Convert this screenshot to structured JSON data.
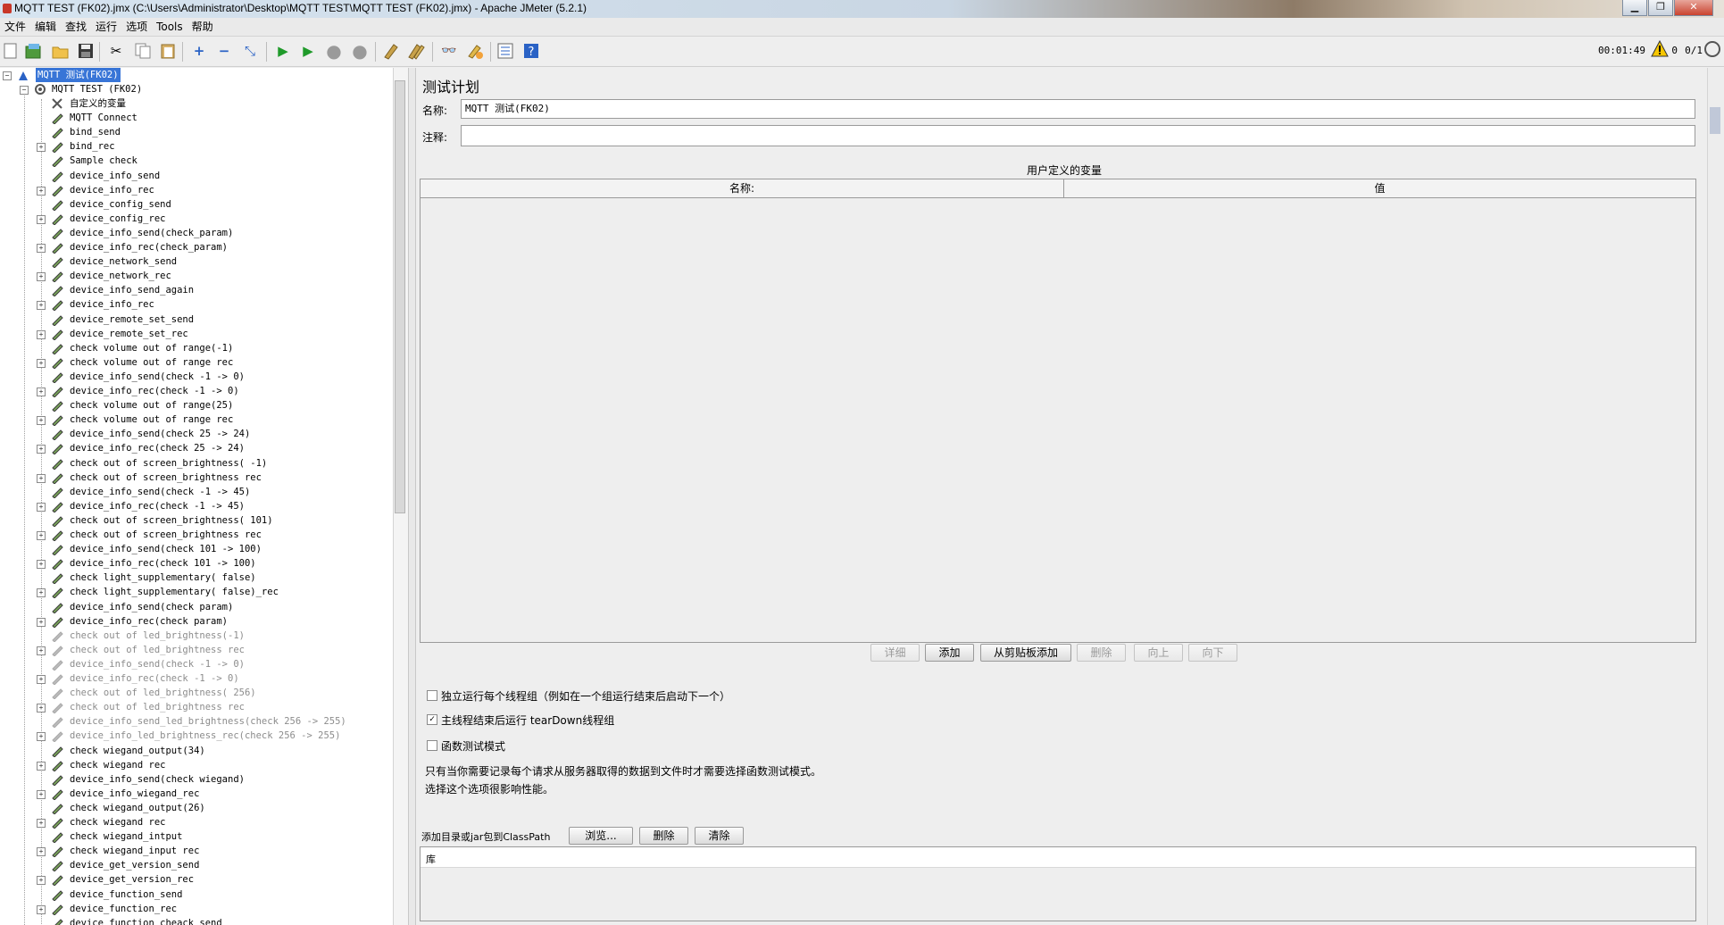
{
  "window": {
    "title": "MQTT TEST (FK02).jmx (C:\\Users\\Administrator\\Desktop\\MQTT TEST\\MQTT TEST (FK02).jmx) - Apache JMeter (5.2.1)"
  },
  "menu": [
    "文件",
    "编辑",
    "查找",
    "运行",
    "选项",
    "Tools",
    "帮助"
  ],
  "toolbar": {
    "icons": [
      "new-icon",
      "templates-icon",
      "open-icon",
      "save-icon",
      "cut-icon",
      "copy-icon",
      "paste-icon",
      "expand-icon",
      "collapse-icon",
      "toggle-icon",
      "start-icon",
      "start-no-pause-icon",
      "stop-icon",
      "shutdown-icon",
      "clear-icon",
      "clear-all-icon",
      "search-icon",
      "reset-search-icon",
      "function-helper-icon",
      "help-icon"
    ],
    "timer": "00:01:49",
    "error_count": "0",
    "thread_count": "0/1"
  },
  "tree": {
    "root": "MQTT 测试(FK02)",
    "plan": "MQTT TEST (FK02)",
    "items": [
      {
        "label": "自定义的变量",
        "expand": false,
        "disabled": false
      },
      {
        "label": "MQTT Connect",
        "expand": false,
        "disabled": false
      },
      {
        "label": "bind_send",
        "expand": false,
        "disabled": false
      },
      {
        "label": "bind_rec",
        "expand": true,
        "disabled": false
      },
      {
        "label": "Sample check",
        "expand": false,
        "disabled": false
      },
      {
        "label": "device_info_send",
        "expand": false,
        "disabled": false
      },
      {
        "label": "device_info_rec",
        "expand": true,
        "disabled": false
      },
      {
        "label": "device_config_send",
        "expand": false,
        "disabled": false
      },
      {
        "label": "device_config_rec",
        "expand": true,
        "disabled": false
      },
      {
        "label": "device_info_send(check_param)",
        "expand": false,
        "disabled": false
      },
      {
        "label": "device_info_rec(check_param)",
        "expand": true,
        "disabled": false
      },
      {
        "label": "device_network_send",
        "expand": false,
        "disabled": false
      },
      {
        "label": "device_network_rec",
        "expand": true,
        "disabled": false
      },
      {
        "label": "device_info_send_again",
        "expand": false,
        "disabled": false
      },
      {
        "label": "device_info_rec",
        "expand": true,
        "disabled": false
      },
      {
        "label": "device_remote_set_send",
        "expand": false,
        "disabled": false
      },
      {
        "label": "device_remote_set_rec",
        "expand": true,
        "disabled": false
      },
      {
        "label": "check volume out of range(-1)",
        "expand": false,
        "disabled": false
      },
      {
        "label": "check volume out of range rec",
        "expand": true,
        "disabled": false
      },
      {
        "label": "device_info_send(check -1 -> 0)",
        "expand": false,
        "disabled": false
      },
      {
        "label": "device_info_rec(check -1 -> 0)",
        "expand": true,
        "disabled": false
      },
      {
        "label": "check volume out of range(25)",
        "expand": false,
        "disabled": false
      },
      {
        "label": "check volume out of range rec",
        "expand": true,
        "disabled": false
      },
      {
        "label": "device_info_send(check 25 -> 24)",
        "expand": false,
        "disabled": false
      },
      {
        "label": "device_info_rec(check 25 -> 24)",
        "expand": true,
        "disabled": false
      },
      {
        "label": "check out of screen_brightness( -1)",
        "expand": false,
        "disabled": false
      },
      {
        "label": "check out of screen_brightness rec",
        "expand": true,
        "disabled": false
      },
      {
        "label": "device_info_send(check -1 -> 45)",
        "expand": false,
        "disabled": false
      },
      {
        "label": "device_info_rec(check -1 -> 45)",
        "expand": true,
        "disabled": false
      },
      {
        "label": "check out of screen_brightness( 101)",
        "expand": false,
        "disabled": false
      },
      {
        "label": "check out of screen_brightness rec",
        "expand": true,
        "disabled": false
      },
      {
        "label": "device_info_send(check 101 -> 100)",
        "expand": false,
        "disabled": false
      },
      {
        "label": "device_info_rec(check 101 -> 100)",
        "expand": true,
        "disabled": false
      },
      {
        "label": "check light_supplementary( false)",
        "expand": false,
        "disabled": false
      },
      {
        "label": "check light_supplementary( false)_rec",
        "expand": true,
        "disabled": false
      },
      {
        "label": "device_info_send(check  param)",
        "expand": false,
        "disabled": false
      },
      {
        "label": "device_info_rec(check  param)",
        "expand": true,
        "disabled": false
      },
      {
        "label": "check  out of led_brightness(-1)",
        "expand": false,
        "disabled": true
      },
      {
        "label": "check out of led_brightness rec",
        "expand": true,
        "disabled": true
      },
      {
        "label": "device_info_send(check -1 -> 0)",
        "expand": false,
        "disabled": true
      },
      {
        "label": "device_info_rec(check -1 -> 0)",
        "expand": true,
        "disabled": true
      },
      {
        "label": "check out of led_brightness( 256)",
        "expand": false,
        "disabled": true
      },
      {
        "label": "check out of led_brightness rec",
        "expand": true,
        "disabled": true
      },
      {
        "label": "device_info_send_led_brightness(check 256 -> 255)",
        "expand": false,
        "disabled": true
      },
      {
        "label": "device_info_led_brightness_rec(check 256 -> 255)",
        "expand": true,
        "disabled": true
      },
      {
        "label": "check wiegand_output(34)",
        "expand": false,
        "disabled": false
      },
      {
        "label": "check wiegand rec",
        "expand": true,
        "disabled": false
      },
      {
        "label": "device_info_send(check wiegand)",
        "expand": false,
        "disabled": false
      },
      {
        "label": "device_info_wiegand_rec",
        "expand": true,
        "disabled": false
      },
      {
        "label": "check wiegand_output(26)",
        "expand": false,
        "disabled": false
      },
      {
        "label": "check wiegand rec",
        "expand": true,
        "disabled": false
      },
      {
        "label": "check wiegand_intput",
        "expand": false,
        "disabled": false
      },
      {
        "label": "check wiegand_input rec",
        "expand": true,
        "disabled": false
      },
      {
        "label": "device_get_version_send",
        "expand": false,
        "disabled": false
      },
      {
        "label": "device_get_version_rec",
        "expand": true,
        "disabled": false
      },
      {
        "label": "device_function_send",
        "expand": false,
        "disabled": false
      },
      {
        "label": "device_function_rec",
        "expand": true,
        "disabled": false
      },
      {
        "label": "device_function_cheack_send",
        "expand": false,
        "disabled": false
      }
    ]
  },
  "panel": {
    "heading": "测试计划",
    "name_label": "名称:",
    "name_value": "MQTT 测试(FK02)",
    "comment_label": "注释:",
    "comment_value": "",
    "table_title": "用户定义的变量",
    "col_name": "名称:",
    "col_value": "值",
    "buttons": [
      {
        "label": "详细",
        "enabled": false
      },
      {
        "label": "添加",
        "enabled": true
      },
      {
        "label": "从剪贴板添加",
        "enabled": true
      },
      {
        "label": "删除",
        "enabled": false
      },
      {
        "label": "向上",
        "enabled": false
      },
      {
        "label": "向下",
        "enabled": false
      }
    ],
    "cb1_label": "独立运行每个线程组（例如在一个组运行结束后启动下一个）",
    "cb1_checked": false,
    "cb2_label": "主线程结束后运行 tearDown线程组",
    "cb2_checked": true,
    "cb3_label": "函数测试模式",
    "cb3_checked": false,
    "note1": "只有当你需要记录每个请求从服务器取得的数据到文件时才需要选择函数测试模式。",
    "note2": "选择这个选项很影响性能。",
    "classpath_label": "添加目录或jar包到ClassPath",
    "browse_btn": "浏览...",
    "delete_btn": "删除",
    "clear_btn": "清除",
    "lib_header": "库"
  }
}
